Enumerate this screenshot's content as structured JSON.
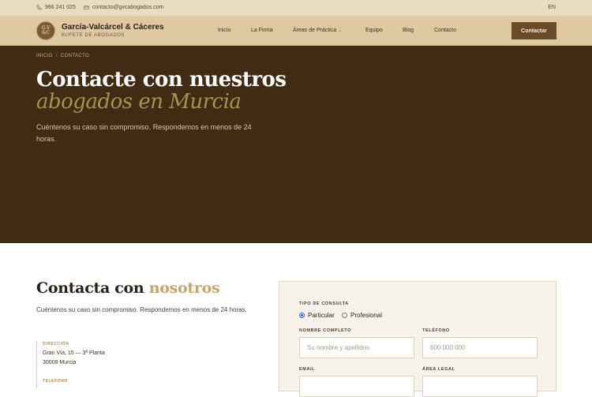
{
  "topbar": {
    "phone": "966 241 025",
    "email": "contacto@gvcabogados.com",
    "language": "EN"
  },
  "brand": {
    "seal_text_1": "G-V",
    "seal_text_2": "&C",
    "name": "García-Valcárcel & Cáceres",
    "subtitle": "BUFETE DE ABOGADOS"
  },
  "nav": {
    "items": [
      {
        "label": "Inicio"
      },
      {
        "label": "La Firma"
      },
      {
        "label": "Áreas de Práctica",
        "dropdown": true
      },
      {
        "label": "Equipo"
      },
      {
        "label": "Blog"
      },
      {
        "label": "Contacto"
      }
    ],
    "cta_label": "Contactar"
  },
  "hero": {
    "breadcrumb": [
      "INICIO",
      "CONTACTO"
    ],
    "breadcrumb_sep": "/",
    "title_line1": "Contacte con nuestros",
    "title_line2": "abogados en Murcia",
    "lead": "Cuéntenos su caso sin compromiso. Respondemos en menos de 24 horas."
  },
  "contact": {
    "title_main": "Contacta con ",
    "title_accent": "nosotros",
    "lead": "Cuéntenos su caso sin compromiso. Respondemos en menos de 24 horas.",
    "address_label": "DIRECCIÓN",
    "address_line1": "Gran Vía, 15 — 3ª Planta",
    "address_line2": "30008 Murcia",
    "next_label": "TELÉFONO"
  },
  "form": {
    "type_label": "TIPO DE CONSULTA",
    "type_options": [
      "Particular",
      "Profesional"
    ],
    "type_selected": "Particular",
    "name_label": "NOMBRE COMPLETO",
    "name_placeholder": "Su nombre y apellidos",
    "phone_label": "TELÉFONO",
    "phone_placeholder": "600 000 000",
    "email_label": "EMAIL",
    "area_label": "ÁREA LEGAL"
  },
  "colors": {
    "hero_bg": "#412b14",
    "accent_gold": "#c2a66a",
    "cta_bg": "#6b4a2a",
    "topbar_bg": "#e8dcc3",
    "navbar_bg": "#dec9a2"
  }
}
